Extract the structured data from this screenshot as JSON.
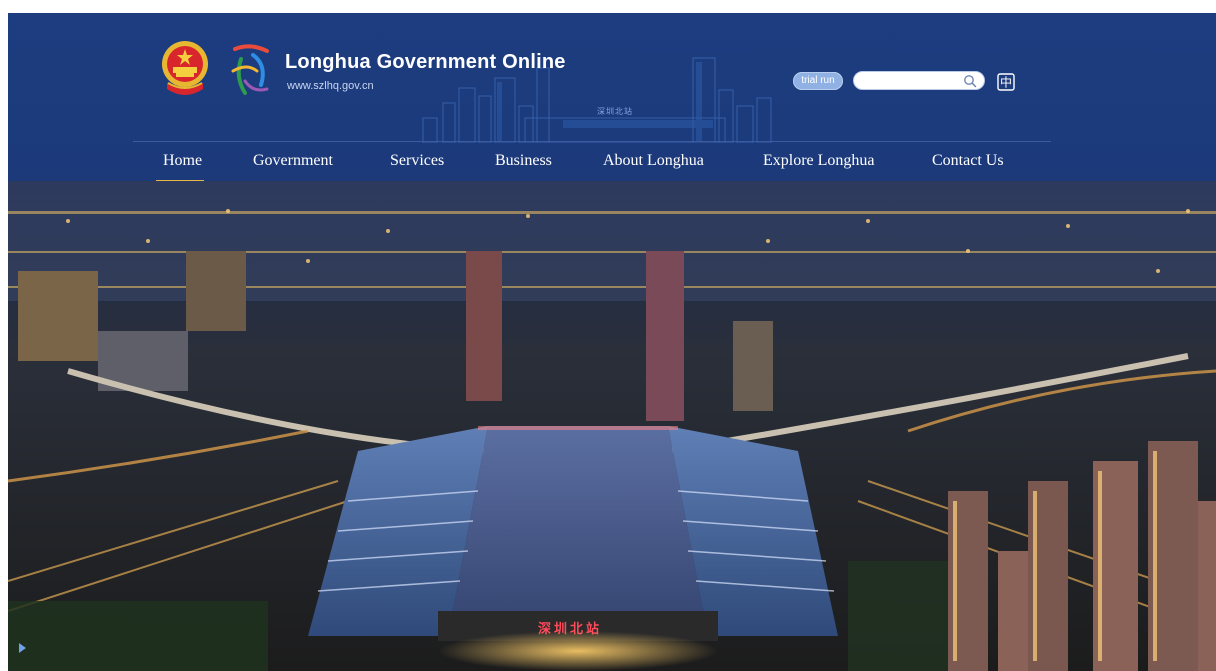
{
  "header": {
    "title": "Longhua Government Online",
    "url": "www.szlhq.gov.cn",
    "trial_badge": "trial run",
    "search": {
      "placeholder": "",
      "value": ""
    },
    "language_toggle": "中",
    "skyline_sign": "深圳北站"
  },
  "nav": {
    "items": [
      {
        "label": "Home",
        "active": true
      },
      {
        "label": "Government"
      },
      {
        "label": "Services"
      },
      {
        "label": "Business"
      },
      {
        "label": "About Longhua"
      },
      {
        "label": "Explore Longhua"
      },
      {
        "label": "Contact Us"
      }
    ]
  },
  "hero": {
    "station_sign": "深圳北站",
    "description_icon": "night-aerial-city-photo"
  },
  "colors": {
    "header_bg": "#1c3a7a",
    "nav_active_underline": "#e6b84a",
    "trial_badge_bg": "#8fb1e3"
  }
}
